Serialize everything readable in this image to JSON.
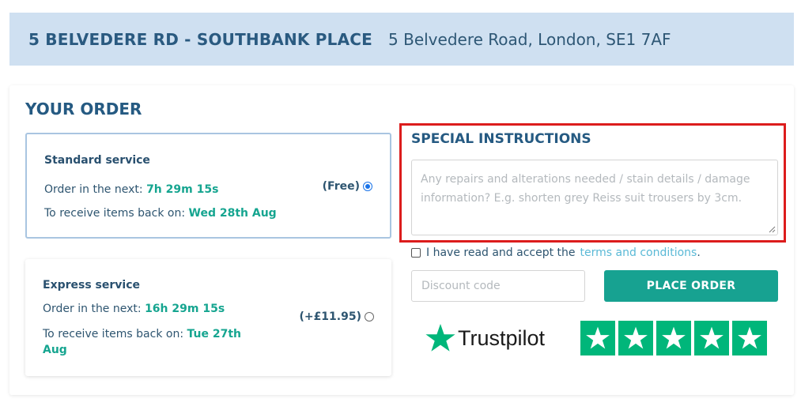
{
  "header": {
    "title": "5 BELVEDERE RD - SOUTHBANK PLACE",
    "address": "5 Belvedere Road, London, SE1 7AF"
  },
  "order": {
    "title": "YOUR ORDER",
    "services": [
      {
        "name": "Standard service",
        "order_in_label": "Order in the next:",
        "order_in_value": "7h 29m 15s",
        "receive_label": "To receive items back on:",
        "receive_value": "Wed 28th Aug",
        "price": "(Free)",
        "selected": true
      },
      {
        "name": "Express service",
        "order_in_label": "Order in the next:",
        "order_in_value": "16h 29m 15s",
        "receive_label": "To receive items back on:",
        "receive_value_line1": "Tue 27th",
        "receive_value_line2": "Aug",
        "price": "(+£11.95)",
        "selected": false
      }
    ]
  },
  "instructions": {
    "title": "SPECIAL INSTRUCTIONS",
    "placeholder": "Any repairs and alterations needed / stain details / damage information? E.g. shorten grey Reiss suit trousers by 3cm.",
    "value": ""
  },
  "terms": {
    "prefix": "I have read and accept the",
    "link": "terms and conditions",
    "suffix": ".",
    "checked": false
  },
  "discount": {
    "placeholder": "Discount code",
    "value": ""
  },
  "actions": {
    "place_order": "PLACE ORDER"
  },
  "trustpilot": {
    "brand": "Trustpilot",
    "stars": 5,
    "color": "#00b67a"
  },
  "colors": {
    "header_bg": "#cfe0f1",
    "heading": "#255a82",
    "accent_teal": "#17a291",
    "highlight_red": "#dc1c1c",
    "link": "#5ab9d6"
  }
}
